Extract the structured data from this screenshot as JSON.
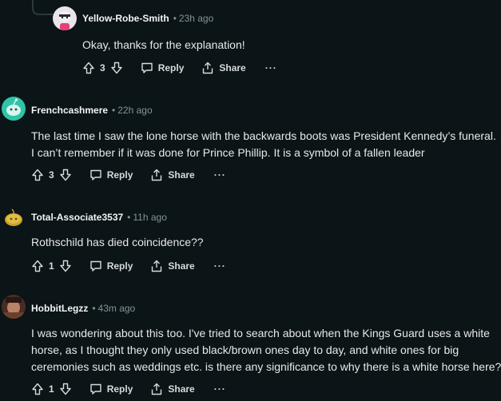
{
  "comments": [
    {
      "user": "Yellow-Robe-Smith",
      "time": "23h ago",
      "lines": [
        "Okay, thanks for the explanation!"
      ],
      "score": "3"
    },
    {
      "user": "Frenchcashmere",
      "time": "22h ago",
      "lines": [
        "The last time I saw the lone horse with the backwards boots was President Kennedy’s funeral.",
        "I can’t remember if it was done for Prince Phillip. It is a symbol of a fallen leader"
      ],
      "score": "3"
    },
    {
      "user": "Total-Associate3537",
      "time": "11h ago",
      "lines": [
        "Rothschild has died coincidence??"
      ],
      "score": "1"
    },
    {
      "user": "HobbitLegzz",
      "time": "43m ago",
      "lines": [
        "I was wondering about this too. I've tried to search about when the Kings Guard uses a white",
        "horse, as I thought they only used black/brown ones day to day, and white ones for big",
        "ceremonies such as weddings etc. is there any significance to why there is a white horse here?"
      ],
      "score": "1"
    }
  ],
  "labels": {
    "reply": "Reply",
    "share": "Share",
    "more": "···",
    "separator": "•"
  },
  "colors": {
    "background": "#0b1416",
    "muted": "#82959b",
    "avatar_teal": "#2ec4a8",
    "avatar_gold": "#c9a227"
  },
  "icons": [
    "upvote-icon",
    "downvote-icon",
    "reply-icon",
    "share-icon",
    "more-icon"
  ]
}
